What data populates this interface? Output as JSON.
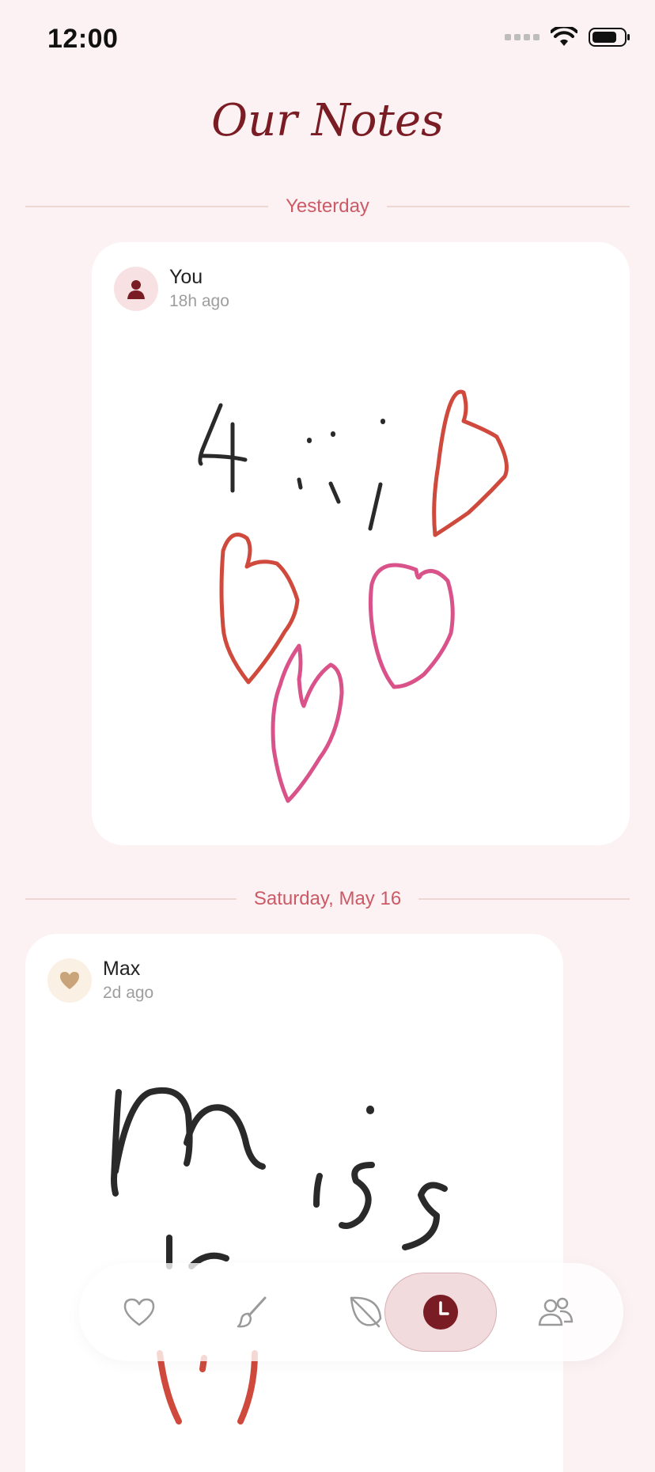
{
  "status_bar": {
    "time": "12:00"
  },
  "header": {
    "title": "Our Notes"
  },
  "sections": [
    {
      "date_label": "Yesterday",
      "note": {
        "author": "You",
        "time_ago": "18h ago",
        "avatar_icon": "person-icon"
      }
    },
    {
      "date_label": "Saturday, May 16",
      "note": {
        "author": "Max",
        "time_ago": "2d ago",
        "avatar_icon": "heart-icon"
      }
    }
  ],
  "tab_bar": {
    "tabs": [
      {
        "icon": "heart-icon",
        "active": false
      },
      {
        "icon": "brush-icon",
        "active": false
      },
      {
        "icon": "leaf-icon",
        "active": false
      },
      {
        "icon": "clock-icon",
        "active": true
      },
      {
        "icon": "people-icon",
        "active": false
      }
    ]
  },
  "colors": {
    "accent": "#7a1c24",
    "date_label": "#cc5a66",
    "background": "#fcf2f3",
    "ink_black": "#2a2a2a",
    "ink_red": "#cf4a3d",
    "ink_pink": "#d9538a"
  }
}
